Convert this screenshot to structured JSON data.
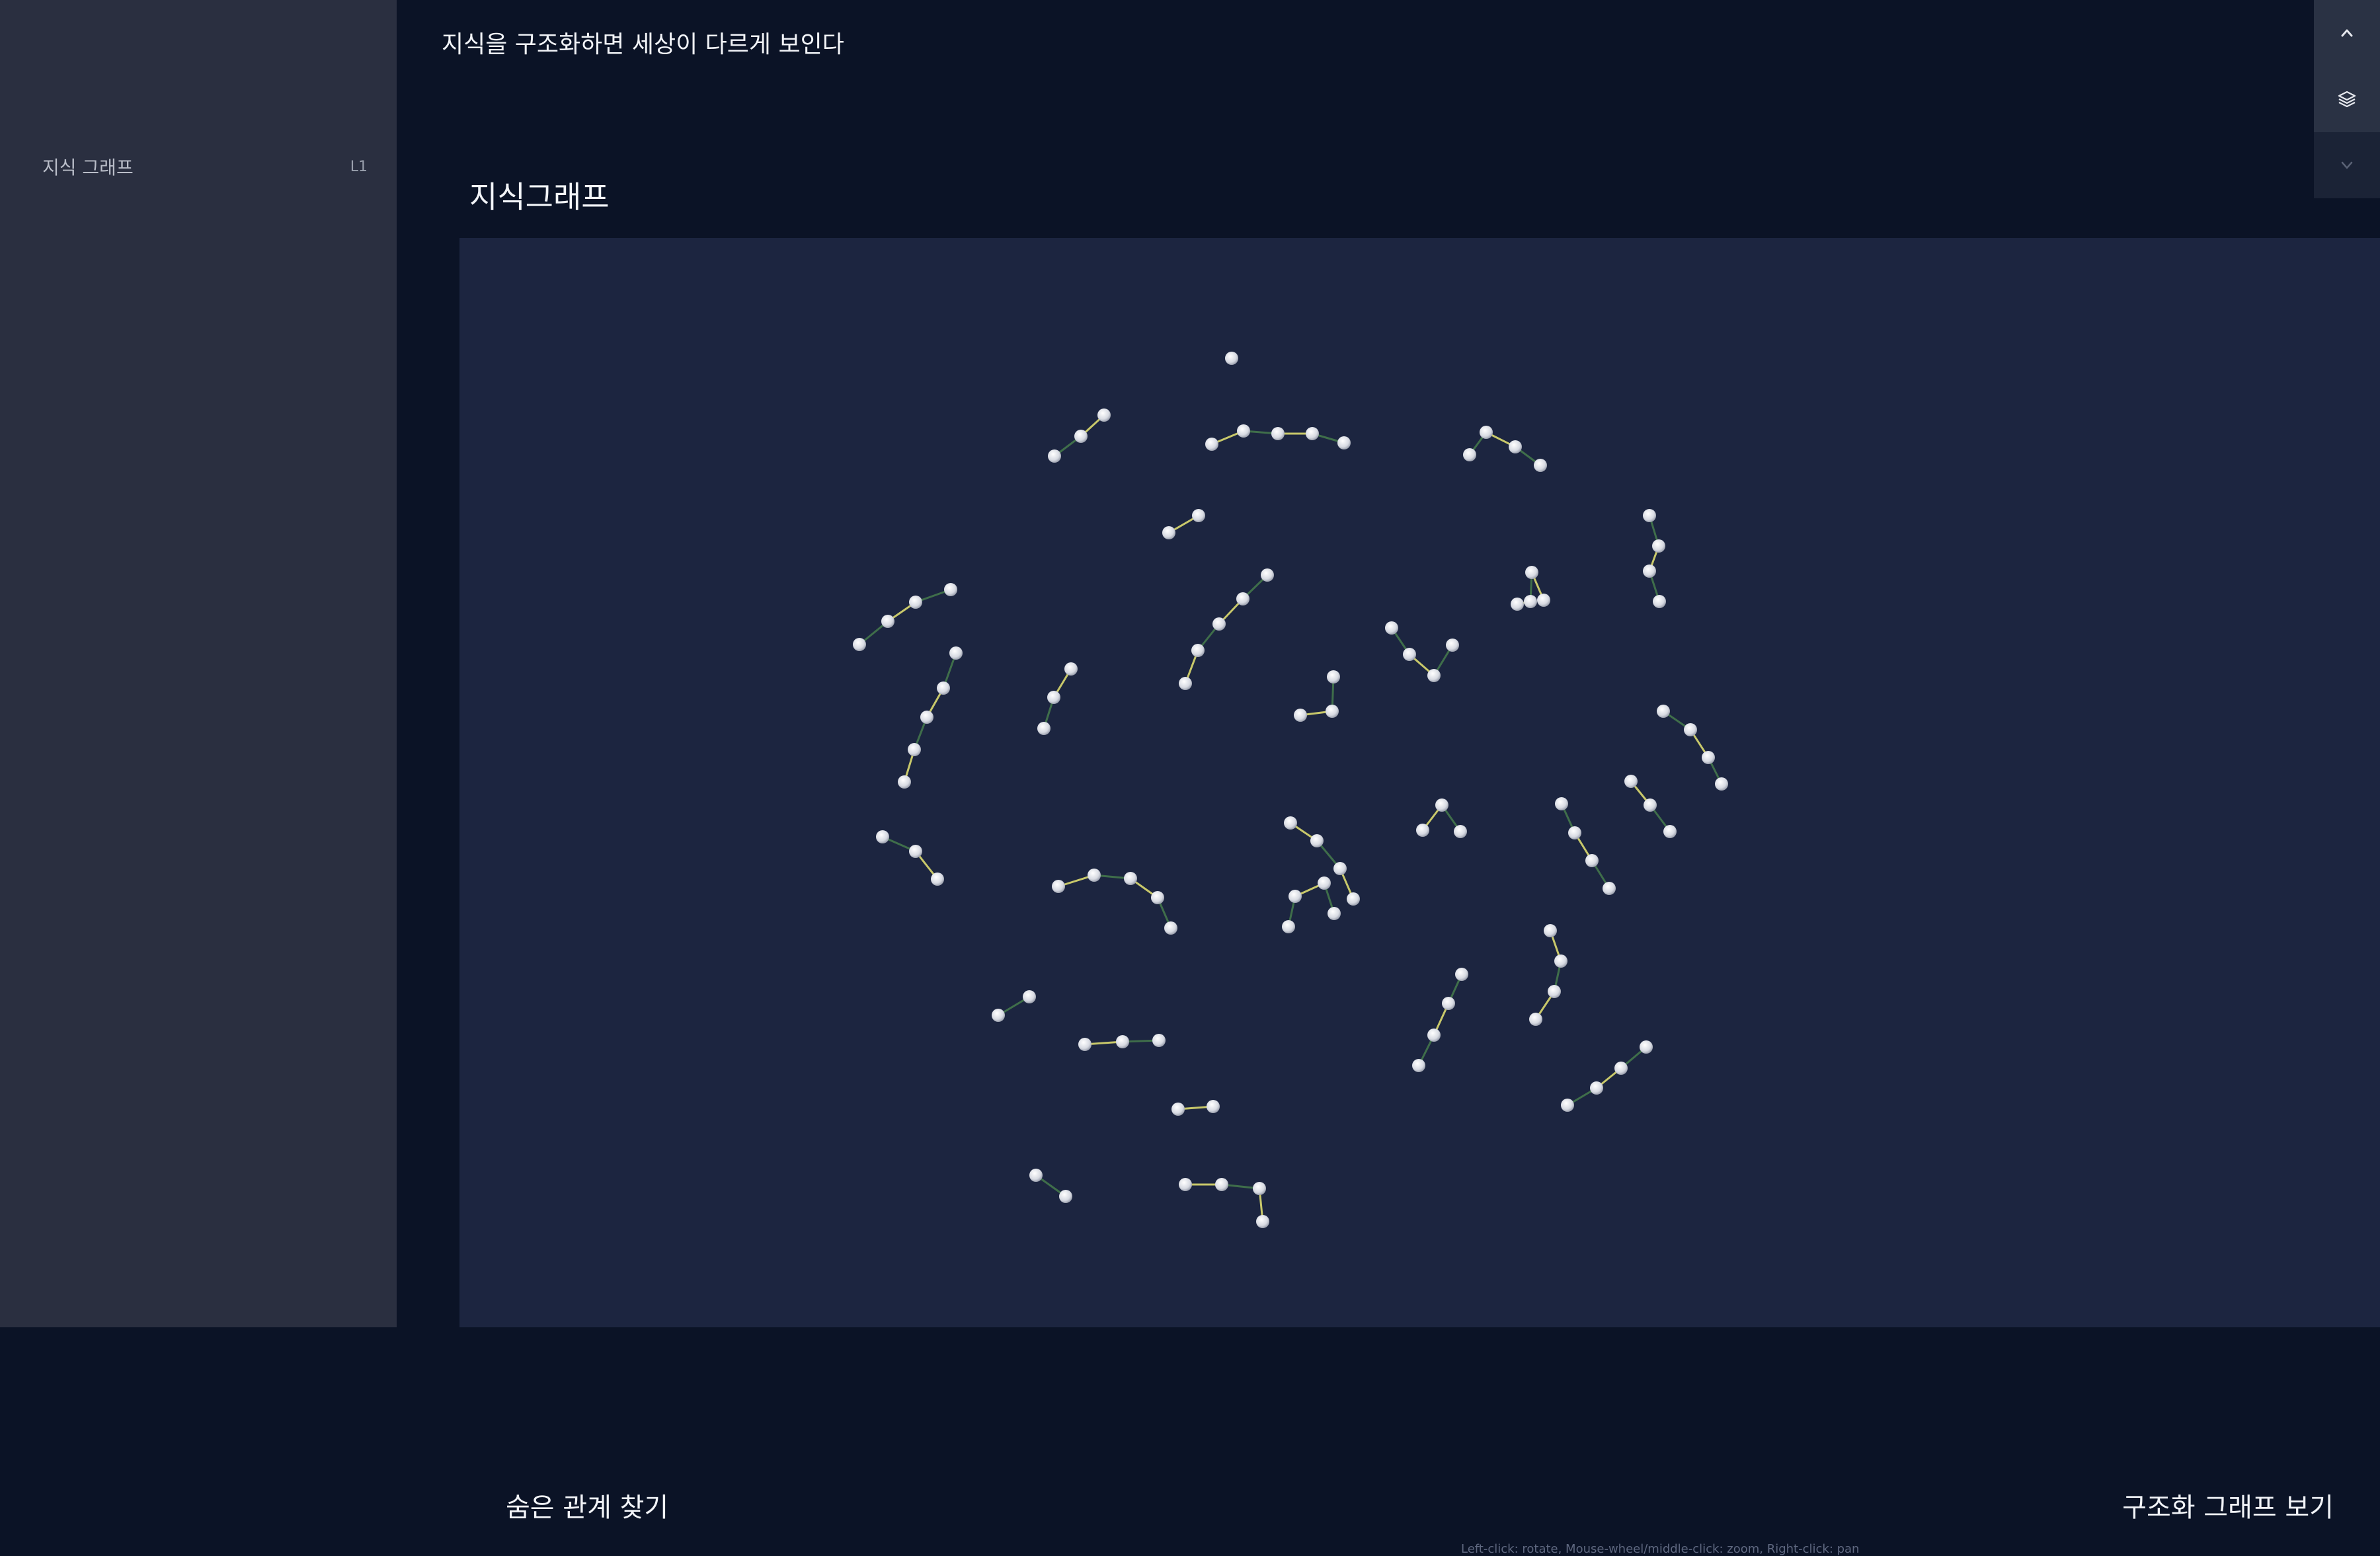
{
  "sidebar": {
    "items": [
      {
        "label": "지식 그래프",
        "level": "L1"
      }
    ]
  },
  "header": {
    "title": "지식을 구조화하면 세상이 다르게 보인다"
  },
  "section": {
    "title": "지식그래프"
  },
  "graph": {
    "left_action": "숨은 관계 찾기",
    "right_action": "구조화 그래프 보기",
    "controls_hint": "Left-click: rotate, Mouse-wheel/middle-click: zoom, Right-click: pan"
  },
  "toolbar": {
    "buttons": [
      {
        "icon": "chevron-up-icon"
      },
      {
        "icon": "layers-icon"
      },
      {
        "icon": "chevron-down-icon"
      }
    ]
  },
  "colors": {
    "sidebar_bg": "#2a2f40",
    "main_bg": "#0b1326",
    "graph_bg": "#1c2540",
    "node": "#e6e8ee",
    "edge_yellow": "#c8c86a",
    "edge_green": "#3f6e4a"
  }
}
